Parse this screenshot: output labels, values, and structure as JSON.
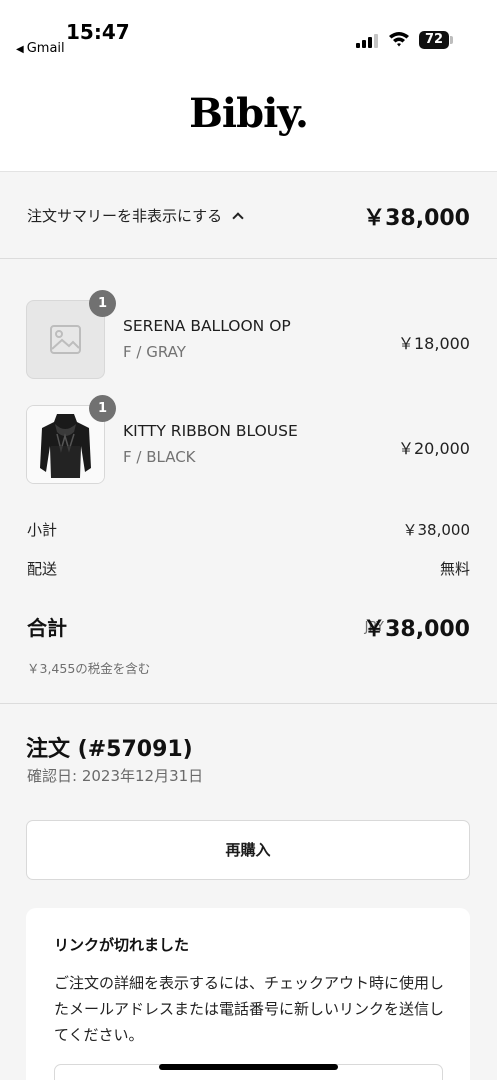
{
  "status_bar": {
    "time": "15:47",
    "back_app": "Gmail",
    "battery": "72"
  },
  "brand": {
    "logo": "Bibiy."
  },
  "summary_toggle": {
    "label": "注文サマリーを非表示にする",
    "total": "￥38,000"
  },
  "items": [
    {
      "name": "SERENA BALLOON OP",
      "variant": "F / GRAY",
      "price": "￥18,000",
      "quantity": "1",
      "image": "placeholder-image-icon"
    },
    {
      "name": "KITTY RIBBON BLOUSE",
      "variant": "F / BLACK",
      "price": "￥20,000",
      "quantity": "1",
      "image": "black-blouse-photo"
    }
  ],
  "subtotal": {
    "label": "小計",
    "value": "￥38,000"
  },
  "shipping": {
    "label": "配送",
    "value": "無料"
  },
  "total": {
    "label": "合計",
    "currency": "JPY",
    "value": "￥38,000",
    "tax_note": "￥3,455の税金を含む"
  },
  "order": {
    "title": "注文 (#57091)",
    "date": "確認日: 2023年12月31日",
    "rebuy_label": "再購入"
  },
  "link_expired": {
    "title": "リンクが切れました",
    "message": "ご注文の詳細を表示するには、チェックアウト時に使用したメールアドレスまたは電話番号に新しいリンクを送信してください。"
  },
  "colors": {
    "page_background": "#f5f5f5",
    "badge": "#717171",
    "muted_text": "#737373"
  }
}
